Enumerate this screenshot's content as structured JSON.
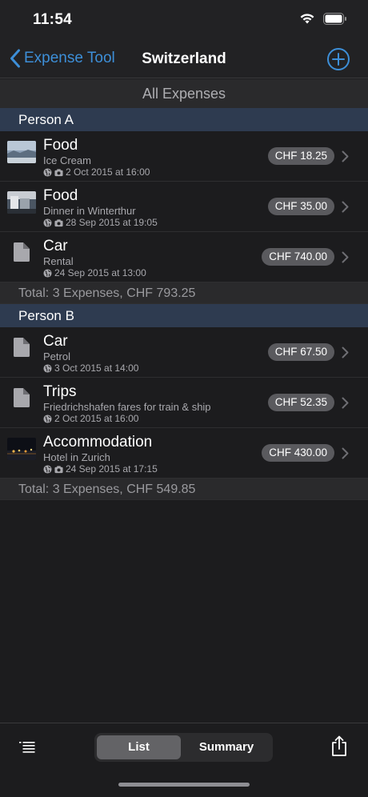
{
  "status": {
    "time": "11:54"
  },
  "nav": {
    "back_label": "Expense Tool",
    "title": "Switzerland"
  },
  "filter_label": "All Expenses",
  "sections": [
    {
      "name": "Person A",
      "items": [
        {
          "title": "Food",
          "subtitle": "Ice Cream",
          "date": "2 Oct 2015 at 16:00",
          "amount": "CHF 18.25",
          "thumb": "photo",
          "has_camera": true
        },
        {
          "title": "Food",
          "subtitle": "Dinner in Winterthur",
          "date": "28 Sep 2015 at 19:05",
          "amount": "CHF 35.00",
          "thumb": "photo",
          "has_camera": true
        },
        {
          "title": "Car",
          "subtitle": "Rental",
          "date": "24 Sep 2015 at 13:00",
          "amount": "CHF 740.00",
          "thumb": "document",
          "has_camera": false
        }
      ],
      "total": "Total: 3 Expenses, CHF 793.25"
    },
    {
      "name": "Person B",
      "items": [
        {
          "title": "Car",
          "subtitle": "Petrol",
          "date": "3 Oct 2015 at 14:00",
          "amount": "CHF 67.50",
          "thumb": "document",
          "has_camera": false
        },
        {
          "title": "Trips",
          "subtitle": "Friedrichshafen fares for train & ship",
          "date": "2 Oct 2015 at 16:00",
          "amount": "CHF 52.35",
          "thumb": "document",
          "has_camera": false
        },
        {
          "title": "Accommodation",
          "subtitle": "Hotel in Zurich",
          "date": "24 Sep 2015 at 17:15",
          "amount": "CHF 430.00",
          "thumb": "photo",
          "has_camera": true
        }
      ],
      "total": "Total: 3 Expenses, CHF 549.85"
    }
  ],
  "toolbar": {
    "segments": [
      "List",
      "Summary"
    ],
    "selected": "List"
  },
  "colors": {
    "accent": "#3d8fd8",
    "section_header": "#2e3b50",
    "badge": "#5a5a5e"
  },
  "icons": [
    "back-chevron-icon",
    "add-circle-icon",
    "globe-icon",
    "camera-icon",
    "document-icon",
    "chevron-right-icon",
    "list-menu-icon",
    "share-icon",
    "wifi-icon",
    "battery-icon"
  ]
}
